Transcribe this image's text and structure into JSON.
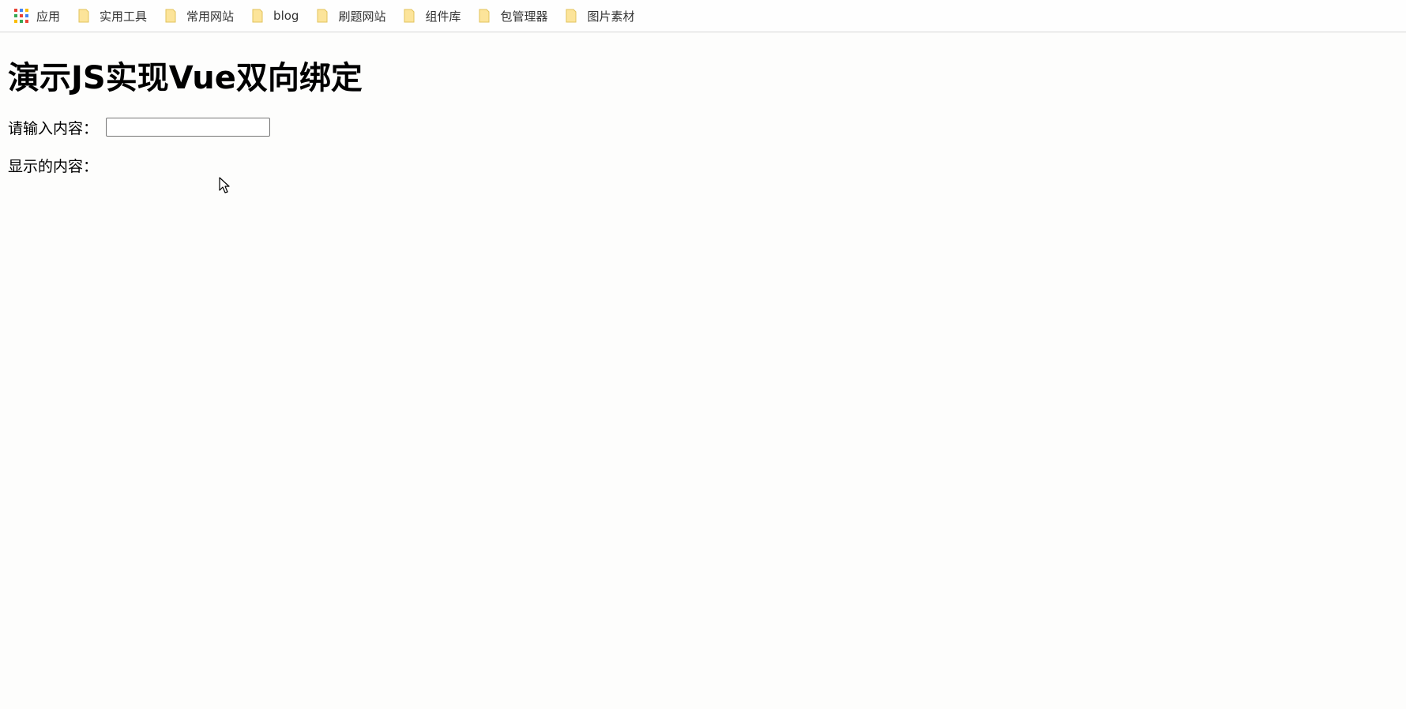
{
  "bookmarks": [
    {
      "label": "应用",
      "icon": "apps-grid-icon"
    },
    {
      "label": "实用工具",
      "icon": "folder-icon"
    },
    {
      "label": "常用网站",
      "icon": "folder-icon"
    },
    {
      "label": "blog",
      "icon": "folder-icon"
    },
    {
      "label": "刷题网站",
      "icon": "folder-icon"
    },
    {
      "label": "组件库",
      "icon": "folder-icon"
    },
    {
      "label": "包管理器",
      "icon": "folder-icon"
    },
    {
      "label": "图片素材",
      "icon": "folder-icon"
    }
  ],
  "page": {
    "title": "演示JS实现Vue双向绑定",
    "input_label": "请输入内容：",
    "input_value": "",
    "display_label": "显示的内容：",
    "display_value": ""
  },
  "colors": {
    "background": "#fdfdfc",
    "folder_fill": "#fce49a",
    "folder_stroke": "#e2c35c"
  }
}
